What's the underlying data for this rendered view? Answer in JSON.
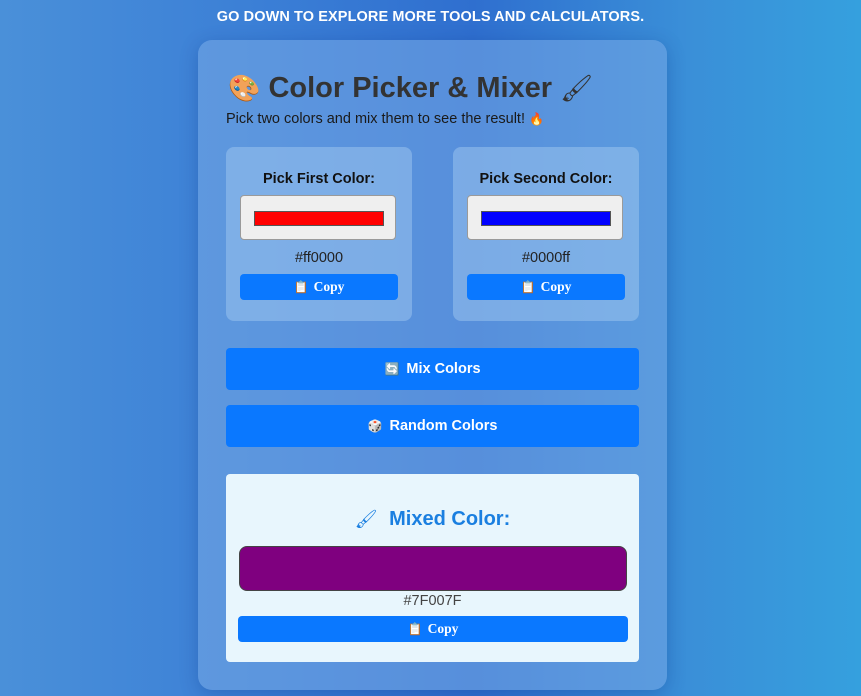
{
  "banner": {
    "text": "GO DOWN TO EXPLORE MORE TOOLS AND CALCULATORS."
  },
  "header": {
    "title": "Color Picker & Mixer",
    "title_icon_left": "🎨",
    "title_icon_right": "🖌",
    "subtitle": "Pick two colors and mix them to see the result!",
    "subtitle_icon": "🔥"
  },
  "pickers": {
    "first": {
      "label": "Pick First Color:",
      "value": "#ff0000",
      "hex_text": "#ff0000",
      "copy_label": "Copy",
      "copy_icon": "📋"
    },
    "second": {
      "label": "Pick Second Color:",
      "value": "#0000ff",
      "hex_text": "#0000ff",
      "copy_label": "Copy",
      "copy_icon": "📋"
    }
  },
  "actions": {
    "mix_label": "Mix Colors",
    "mix_icon": "🔄",
    "random_label": "Random Colors",
    "random_icon": "🎲"
  },
  "result": {
    "title": "Mixed Color:",
    "title_icon": "🖌",
    "value": "#7F007F",
    "hex_text": "#7F007F",
    "copy_label": "Copy",
    "copy_icon": "📋"
  },
  "colors": {
    "accent": "#0a78ff",
    "result_title": "#1a7fe0",
    "result_bg": "#e8f6fd"
  }
}
